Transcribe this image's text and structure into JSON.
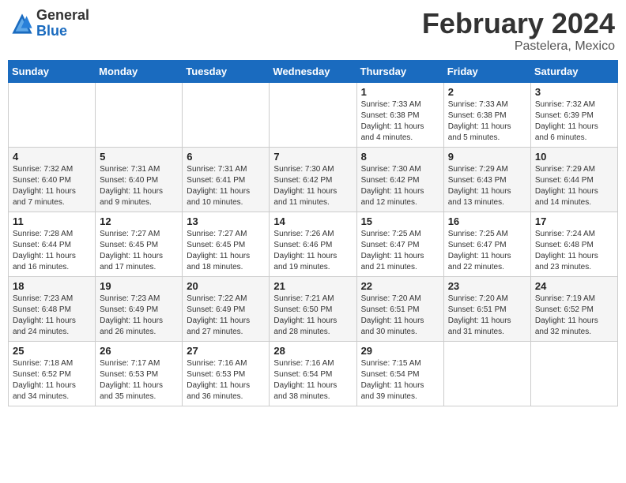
{
  "header": {
    "logo_general": "General",
    "logo_blue": "Blue",
    "month_title": "February 2024",
    "location": "Pastelera, Mexico"
  },
  "weekdays": [
    "Sunday",
    "Monday",
    "Tuesday",
    "Wednesday",
    "Thursday",
    "Friday",
    "Saturday"
  ],
  "weeks": [
    [
      {
        "day": "",
        "info": ""
      },
      {
        "day": "",
        "info": ""
      },
      {
        "day": "",
        "info": ""
      },
      {
        "day": "",
        "info": ""
      },
      {
        "day": "1",
        "info": "Sunrise: 7:33 AM\nSunset: 6:38 PM\nDaylight: 11 hours and 4 minutes."
      },
      {
        "day": "2",
        "info": "Sunrise: 7:33 AM\nSunset: 6:38 PM\nDaylight: 11 hours and 5 minutes."
      },
      {
        "day": "3",
        "info": "Sunrise: 7:32 AM\nSunset: 6:39 PM\nDaylight: 11 hours and 6 minutes."
      }
    ],
    [
      {
        "day": "4",
        "info": "Sunrise: 7:32 AM\nSunset: 6:40 PM\nDaylight: 11 hours and 7 minutes."
      },
      {
        "day": "5",
        "info": "Sunrise: 7:31 AM\nSunset: 6:40 PM\nDaylight: 11 hours and 9 minutes."
      },
      {
        "day": "6",
        "info": "Sunrise: 7:31 AM\nSunset: 6:41 PM\nDaylight: 11 hours and 10 minutes."
      },
      {
        "day": "7",
        "info": "Sunrise: 7:30 AM\nSunset: 6:42 PM\nDaylight: 11 hours and 11 minutes."
      },
      {
        "day": "8",
        "info": "Sunrise: 7:30 AM\nSunset: 6:42 PM\nDaylight: 11 hours and 12 minutes."
      },
      {
        "day": "9",
        "info": "Sunrise: 7:29 AM\nSunset: 6:43 PM\nDaylight: 11 hours and 13 minutes."
      },
      {
        "day": "10",
        "info": "Sunrise: 7:29 AM\nSunset: 6:44 PM\nDaylight: 11 hours and 14 minutes."
      }
    ],
    [
      {
        "day": "11",
        "info": "Sunrise: 7:28 AM\nSunset: 6:44 PM\nDaylight: 11 hours and 16 minutes."
      },
      {
        "day": "12",
        "info": "Sunrise: 7:27 AM\nSunset: 6:45 PM\nDaylight: 11 hours and 17 minutes."
      },
      {
        "day": "13",
        "info": "Sunrise: 7:27 AM\nSunset: 6:45 PM\nDaylight: 11 hours and 18 minutes."
      },
      {
        "day": "14",
        "info": "Sunrise: 7:26 AM\nSunset: 6:46 PM\nDaylight: 11 hours and 19 minutes."
      },
      {
        "day": "15",
        "info": "Sunrise: 7:25 AM\nSunset: 6:47 PM\nDaylight: 11 hours and 21 minutes."
      },
      {
        "day": "16",
        "info": "Sunrise: 7:25 AM\nSunset: 6:47 PM\nDaylight: 11 hours and 22 minutes."
      },
      {
        "day": "17",
        "info": "Sunrise: 7:24 AM\nSunset: 6:48 PM\nDaylight: 11 hours and 23 minutes."
      }
    ],
    [
      {
        "day": "18",
        "info": "Sunrise: 7:23 AM\nSunset: 6:48 PM\nDaylight: 11 hours and 24 minutes."
      },
      {
        "day": "19",
        "info": "Sunrise: 7:23 AM\nSunset: 6:49 PM\nDaylight: 11 hours and 26 minutes."
      },
      {
        "day": "20",
        "info": "Sunrise: 7:22 AM\nSunset: 6:49 PM\nDaylight: 11 hours and 27 minutes."
      },
      {
        "day": "21",
        "info": "Sunrise: 7:21 AM\nSunset: 6:50 PM\nDaylight: 11 hours and 28 minutes."
      },
      {
        "day": "22",
        "info": "Sunrise: 7:20 AM\nSunset: 6:51 PM\nDaylight: 11 hours and 30 minutes."
      },
      {
        "day": "23",
        "info": "Sunrise: 7:20 AM\nSunset: 6:51 PM\nDaylight: 11 hours and 31 minutes."
      },
      {
        "day": "24",
        "info": "Sunrise: 7:19 AM\nSunset: 6:52 PM\nDaylight: 11 hours and 32 minutes."
      }
    ],
    [
      {
        "day": "25",
        "info": "Sunrise: 7:18 AM\nSunset: 6:52 PM\nDaylight: 11 hours and 34 minutes."
      },
      {
        "day": "26",
        "info": "Sunrise: 7:17 AM\nSunset: 6:53 PM\nDaylight: 11 hours and 35 minutes."
      },
      {
        "day": "27",
        "info": "Sunrise: 7:16 AM\nSunset: 6:53 PM\nDaylight: 11 hours and 36 minutes."
      },
      {
        "day": "28",
        "info": "Sunrise: 7:16 AM\nSunset: 6:54 PM\nDaylight: 11 hours and 38 minutes."
      },
      {
        "day": "29",
        "info": "Sunrise: 7:15 AM\nSunset: 6:54 PM\nDaylight: 11 hours and 39 minutes."
      },
      {
        "day": "",
        "info": ""
      },
      {
        "day": "",
        "info": ""
      }
    ]
  ]
}
